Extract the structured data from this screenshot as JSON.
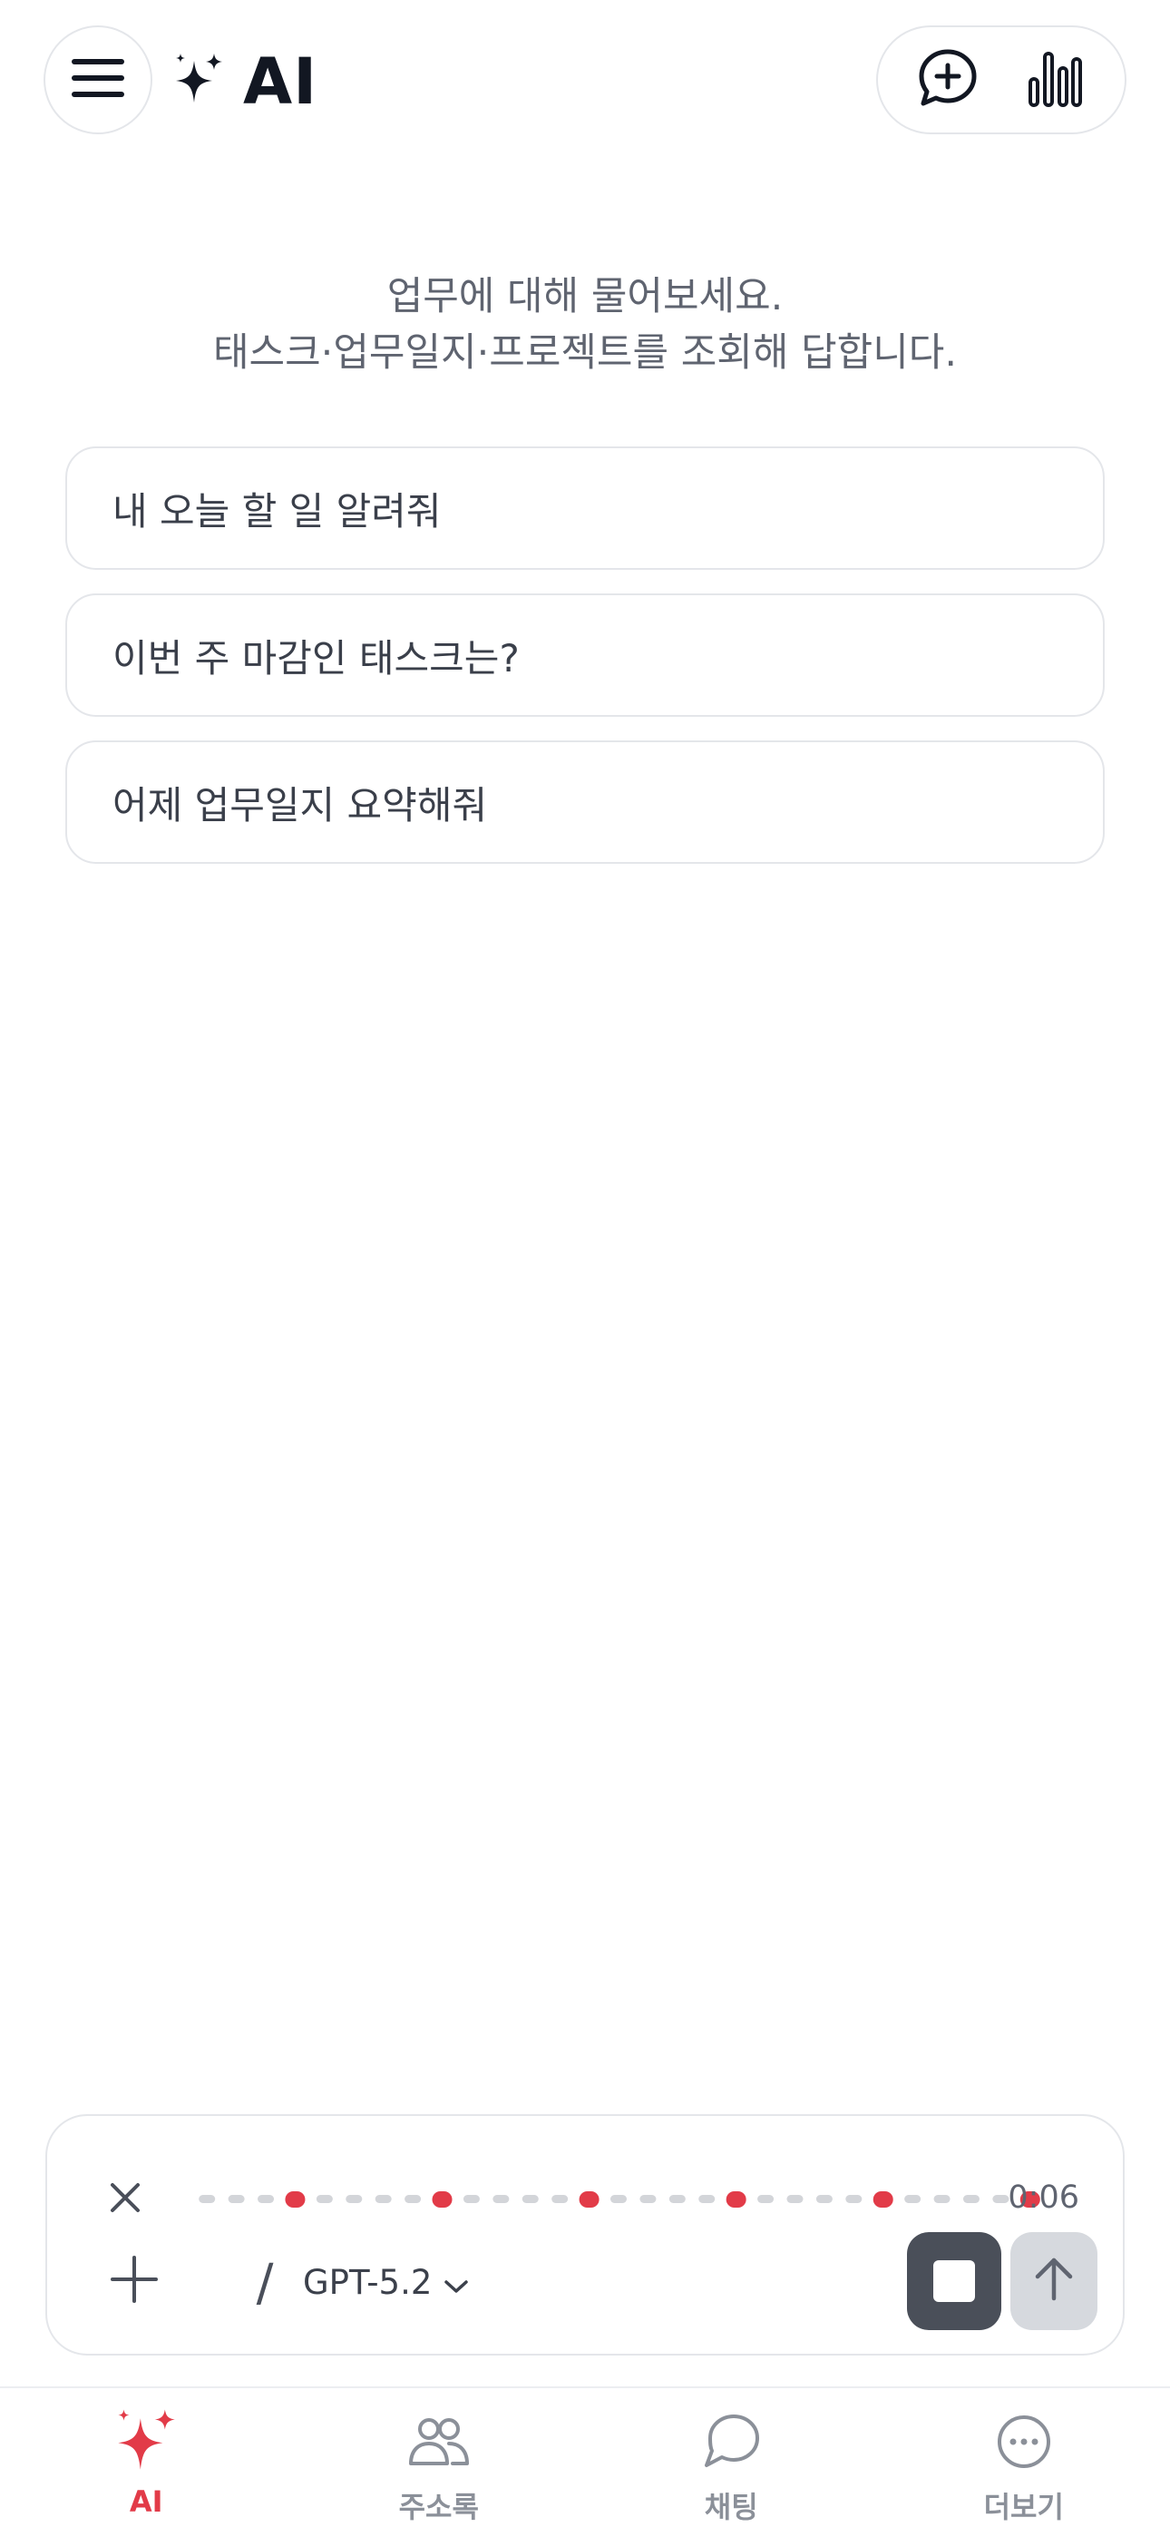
{
  "header": {
    "title": "AI",
    "menu_icon": "hamburger-icon",
    "brand_icon": "sparkle-icon",
    "actions": [
      {
        "name": "new-chat-button",
        "icon": "chat-plus-icon"
      },
      {
        "name": "stats-button",
        "icon": "bar-chart-icon"
      }
    ]
  },
  "intro": {
    "line1": "업무에 대해 물어보세요.",
    "line2": "태스크·업무일지·프로젝트를 조회해 답합니다."
  },
  "suggestions": [
    {
      "label": "내 오늘 할 일 알려줘"
    },
    {
      "label": "이번 주 마감인 태스크는?"
    },
    {
      "label": "어제 업무일지 요약해줘"
    }
  ],
  "composer": {
    "recording_time": "0:06",
    "slash_label": "/",
    "model": "GPT-5.2",
    "icons": {
      "close": "close-icon",
      "plus": "plus-icon",
      "model_dropdown": "chevron-down-icon",
      "stop": "stop-icon",
      "send": "arrow-up-icon"
    }
  },
  "nav": {
    "items": [
      {
        "label": "AI",
        "icon": "sparkle-icon",
        "active": true
      },
      {
        "label": "주소록",
        "icon": "people-icon",
        "active": false
      },
      {
        "label": "채팅",
        "icon": "chat-bubble-icon",
        "active": false
      },
      {
        "label": "더보기",
        "icon": "more-icon",
        "active": false
      }
    ]
  },
  "colors": {
    "accent": "#e23b48",
    "text_dark": "#121722",
    "muted": "#8b9099",
    "border": "#e4e6ea",
    "stop_button": "#4a4f59",
    "send_button": "#d6d9de",
    "wave_idle": "#d3d5d9",
    "wave_active": "#e23b48"
  }
}
